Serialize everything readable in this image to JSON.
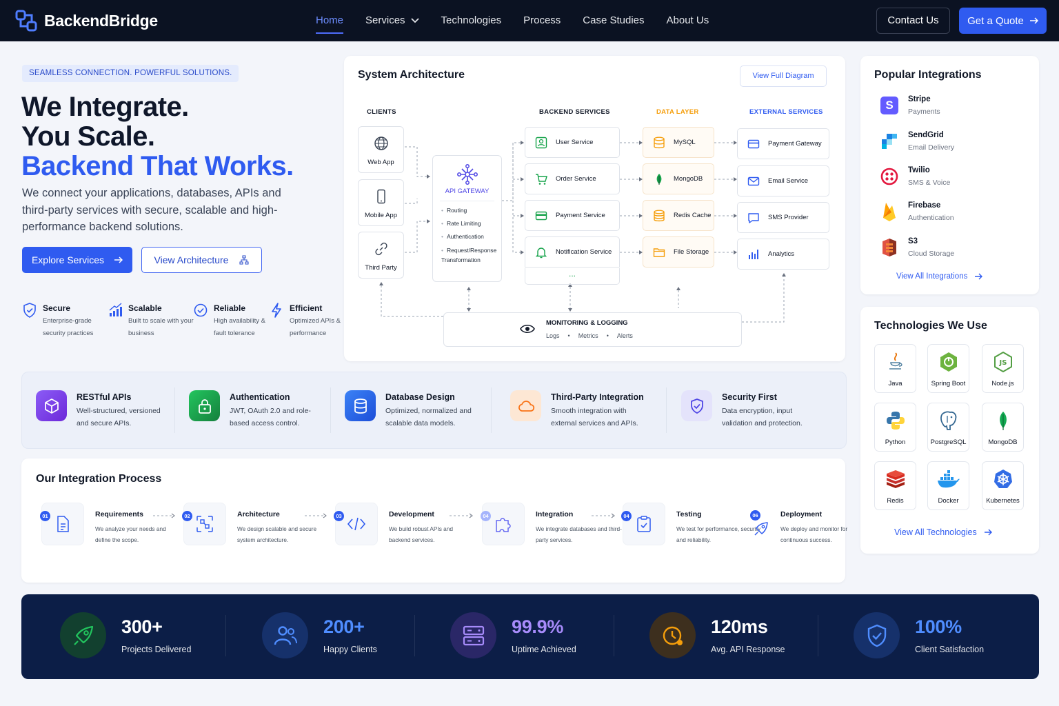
{
  "nav": {
    "brand": "BackendBridge",
    "links": [
      "Home",
      "Services",
      "Technologies",
      "Process",
      "Case Studies",
      "About Us"
    ],
    "contact": "Contact Us",
    "quote": "Get a Quote"
  },
  "hero": {
    "tagline": "SEAMLESS CONNECTION. POWERFUL SOLUTIONS.",
    "line1": "We Integrate.",
    "line2": "You Scale.",
    "line3": "Backend That Works.",
    "description": "We connect your applications, databases, APIs and third-party services with secure, scalable and high-performance backend solutions.",
    "explore": "Explore Services",
    "view_arch": "View Architecture",
    "features": [
      {
        "title": "Secure",
        "desc": "Enterprise-grade security practices"
      },
      {
        "title": "Scalable",
        "desc": "Built to scale with your business"
      },
      {
        "title": "Reliable",
        "desc": "High availability & fault tolerance"
      },
      {
        "title": "Efficient",
        "desc": "Optimized APIs & performance"
      }
    ]
  },
  "arch": {
    "title": "System Architecture",
    "view_full": "View Full Diagram",
    "col_clients": "CLIENTS",
    "col_backend": "BACKEND SERVICES",
    "col_data": "DATA LAYER",
    "col_external": "EXTERNAL SERVICES",
    "clients": [
      "Web App",
      "Mobile App",
      "Third Party"
    ],
    "gateway_title": "API GATEWAY",
    "gateway_items": [
      "Routing",
      "Rate Limiting",
      "Authentication",
      "Request/Response Transformation"
    ],
    "services": [
      "User Service",
      "Order Service",
      "Payment Service",
      "Notification Service"
    ],
    "more": "...",
    "data": [
      "MySQL",
      "MongoDB",
      "Redis Cache",
      "File Storage"
    ],
    "external": [
      "Payment Gateway",
      "Email Service",
      "SMS Provider",
      "Analytics"
    ],
    "monitor_title": "MONITORING & LOGGING",
    "monitor_items": [
      "Logs",
      "Metrics",
      "Alerts"
    ]
  },
  "integrations": {
    "title": "Popular Integrations",
    "items": [
      {
        "name": "Stripe",
        "sub": "Payments"
      },
      {
        "name": "SendGrid",
        "sub": "Email Delivery"
      },
      {
        "name": "Twilio",
        "sub": "SMS & Voice"
      },
      {
        "name": "Firebase",
        "sub": "Authentication"
      },
      {
        "name": "S3",
        "sub": "Cloud Storage"
      }
    ],
    "view_all": "View All Integrations"
  },
  "tech": {
    "title": "Technologies We Use",
    "items": [
      "Java",
      "Spring Boot",
      "Node.js",
      "Python",
      "PostgreSQL",
      "MongoDB",
      "Redis",
      "Docker",
      "Kubernetes"
    ],
    "view_all": "View All Technologies"
  },
  "band": [
    {
      "title": "RESTful APIs",
      "desc1": "Well-structured, versioned",
      "desc2": "and secure APIs."
    },
    {
      "title": "Authentication",
      "desc1": "JWT, OAuth 2.0 and role-",
      "desc2": "based access control."
    },
    {
      "title": "Database Design",
      "desc1": "Optimized, normalized and",
      "desc2": "scalable data models."
    },
    {
      "title": "Third-Party Integration",
      "desc1": "Smooth integration with",
      "desc2": "external services and APIs."
    },
    {
      "title": "Security First",
      "desc1": "Data encryption, input",
      "desc2": "validation and protection."
    }
  ],
  "process": {
    "title": "Our Integration Process",
    "steps": [
      {
        "num": "01",
        "title": "Requirements",
        "desc": "We analyze your needs and define the scope."
      },
      {
        "num": "02",
        "title": "Architecture",
        "desc": "We design scalable and secure system architecture."
      },
      {
        "num": "03",
        "title": "Development",
        "desc": "We build robust APIs and backend services."
      },
      {
        "num": "04",
        "title": "Integration",
        "desc": "We integrate databases and third-party services."
      },
      {
        "num": "04",
        "title": "Testing",
        "desc": "We test for performance, security and reliability."
      },
      {
        "num": "06",
        "title": "Deployment",
        "desc": "We deploy and monitor for continuous success."
      }
    ]
  },
  "stats": [
    {
      "value": "300+",
      "label": "Projects Delivered",
      "color": "#ffffff"
    },
    {
      "value": "200+",
      "label": "Happy Clients",
      "color": "#4f8dff"
    },
    {
      "value": "99.9%",
      "label": "Uptime Achieved",
      "color": "#a78bfa"
    },
    {
      "value": "120ms",
      "label": "Avg. API Response",
      "color": "#ffffff"
    },
    {
      "value": "100%",
      "label": "Client Satisfaction",
      "color": "#4f8dff"
    }
  ],
  "colors": {
    "accent": "#2f5bf0",
    "navy": "#0b1222",
    "stats_bg": "#0c1e47"
  }
}
